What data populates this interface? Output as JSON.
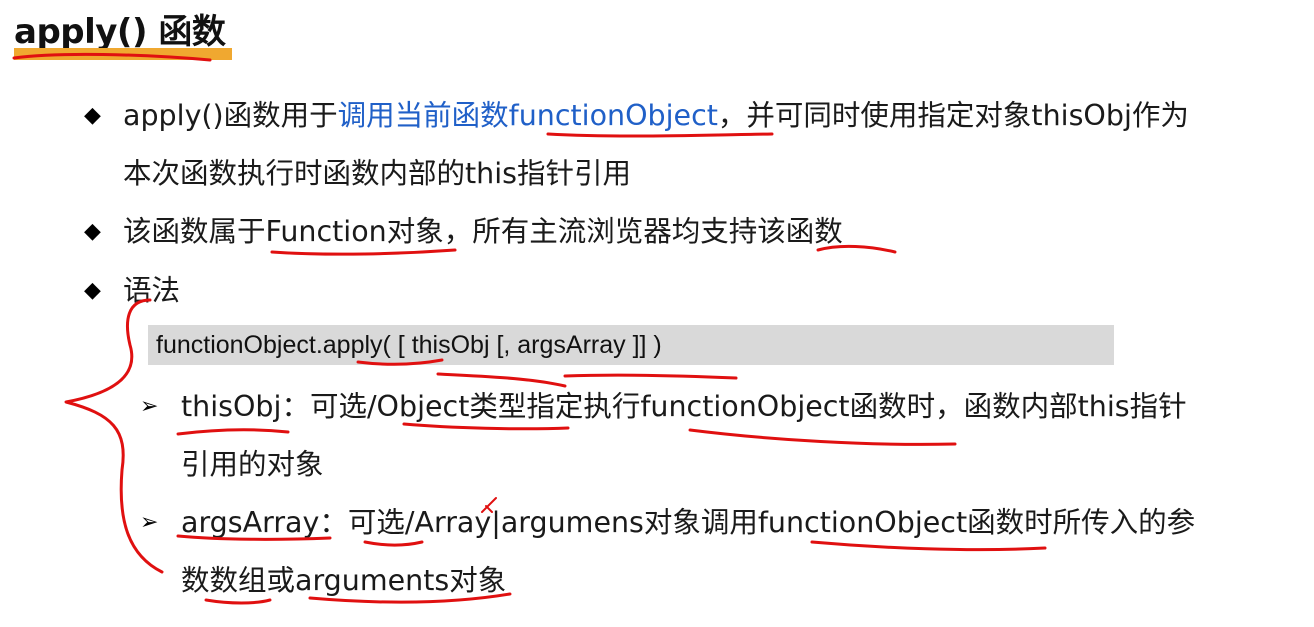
{
  "title": "apply() 函数",
  "bullets": [
    {
      "line1": {
        "pre": "apply()函数用于",
        "hl": "调用当前函数functionObject",
        "post": "，并可同时使用指定对象thisObj作为"
      },
      "line2": "本次函数执行时函数内部的this指针引用"
    },
    {
      "text": "该函数属于Function对象，所有主流浏览器均支持该函数"
    },
    {
      "text": "语法"
    }
  ],
  "syntax": "functionObject.apply( [ thisObj [, argsArray ]] )",
  "params": [
    {
      "line1": "thisObj：可选/Object类型指定执行functionObject函数时，函数内部this指针",
      "line2": "引用的对象"
    },
    {
      "line1": "argsArray：可选/Array|argumens对象调用functionObject函数时所传入的参",
      "line2": "数数组或arguments对象"
    }
  ],
  "glyphs": {
    "bullet": "◆",
    "sub_bullet": "➢"
  },
  "colors": {
    "highlight": "#2060c8",
    "annotation": "#e01010",
    "title_underline": "#f0a830",
    "code_bg": "#d9d9d9"
  }
}
